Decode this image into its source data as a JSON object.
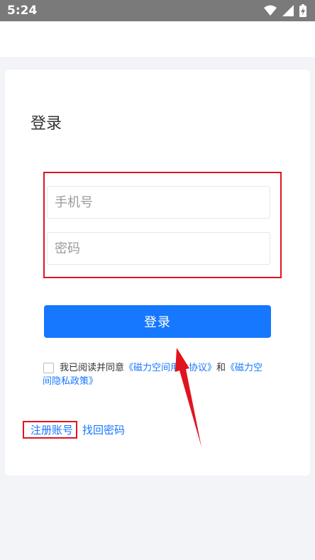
{
  "status_bar": {
    "time": "5:24",
    "icons": [
      "wifi-icon",
      "signal-icon",
      "battery-icon"
    ]
  },
  "page": {
    "title": "登录"
  },
  "form": {
    "phone_placeholder": "手机号",
    "password_placeholder": "密码",
    "login_button": "登录"
  },
  "agreement": {
    "prefix": "我已阅读并同意",
    "user_agreement": "《磁力空间用户协议》",
    "conjunction": "和",
    "privacy_part1": "《磁力空",
    "privacy_part2": "间隐私政策》",
    "checked": false
  },
  "links": {
    "register": "注册账号",
    "find_password": "找回密码"
  },
  "colors": {
    "accent": "#1677ff",
    "annotation": "#e0141e",
    "status_bar": "#7a7a7a"
  }
}
